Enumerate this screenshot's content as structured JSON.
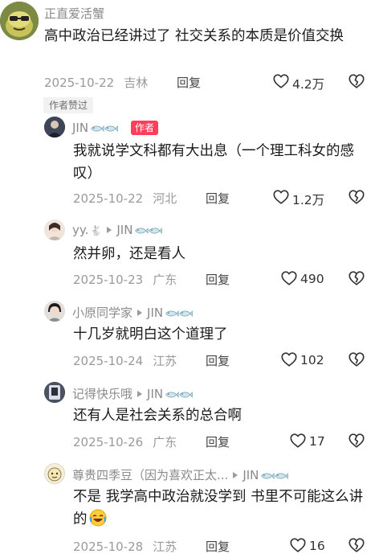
{
  "top_comment": {
    "username": "正直爱活蟹",
    "text": "高中政治已经讲过了 社交关系的本质是价值交换",
    "date": "2025-10-22",
    "location": "吉林",
    "reply_label": "回复",
    "likes": "4.2万",
    "liked_by_author_tag": "作者赞过"
  },
  "replies": [
    {
      "username": "JIN",
      "author_badge": "作者",
      "reply_to": "",
      "text": "我就说学文科都有大出息（一个理工科女的感叹）",
      "date": "2025-10-22",
      "location": "河北",
      "reply_label": "回复",
      "likes": "1.2万"
    },
    {
      "username": "yy.",
      "author_badge": "",
      "reply_to": "JIN",
      "text": "然并卵，还是看人",
      "date": "2025-10-23",
      "location": "广东",
      "reply_label": "回复",
      "likes": "490"
    },
    {
      "username": "小原同学家",
      "author_badge": "",
      "reply_to": "JIN",
      "text": "十几岁就明白这个道理了",
      "date": "2025-10-24",
      "location": "江苏",
      "reply_label": "回复",
      "likes": "102"
    },
    {
      "username": "记得快乐哦",
      "author_badge": "",
      "reply_to": "JIN",
      "text": "还有人是社会关系的总合啊",
      "date": "2025-10-26",
      "location": "广东",
      "reply_label": "回复",
      "likes": "17"
    },
    {
      "username": "尊贵四季豆（因为喜欢正太...",
      "author_badge": "",
      "reply_to": "JIN",
      "text": "不是 我学高中政治就没学到 书里不可能这么讲的",
      "date": "2025-10-28",
      "location": "江苏",
      "reply_label": "回复",
      "likes": "16"
    }
  ],
  "icons": {
    "like": "heart-outline-icon",
    "dislike": "broken-heart-icon",
    "fan_badge": "fish-badge-icon",
    "emoji": "laughing-tears-emoji"
  }
}
